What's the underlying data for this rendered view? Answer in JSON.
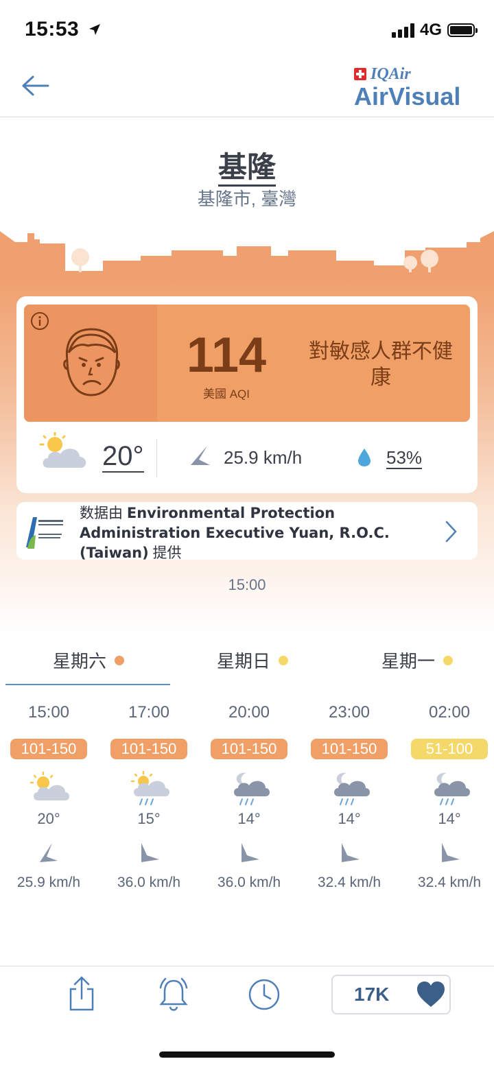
{
  "status_bar": {
    "time": "15:53",
    "network": "4G"
  },
  "header": {
    "back_icon": "arrow-left-icon",
    "logo_top": "IQAir",
    "logo_bottom": "AirVisual"
  },
  "location": {
    "city": "基隆",
    "region": "基隆市, 臺灣"
  },
  "aqi": {
    "value": "114",
    "label": "美國 AQI",
    "status": "對敏感人群不健康",
    "color": "#f0a066"
  },
  "current": {
    "temperature": "20°",
    "wind": "25.9 km/h",
    "humidity": "53%",
    "weather_icon": "partly-sunny-icon"
  },
  "source": {
    "prefix": "数据由 ",
    "name": "Environmental Protection Administration Executive Yuan, R.O.C. (Taiwan)",
    "suffix": " 提供"
  },
  "updated_time": "15:00",
  "days": [
    {
      "label": "星期六",
      "dot_color": "#f0a066"
    },
    {
      "label": "星期日",
      "dot_color": "#f5d86a"
    },
    {
      "label": "星期一",
      "dot_color": "#f5d86a"
    }
  ],
  "hourly": [
    {
      "time": "15:00",
      "aqi_range": "101-150",
      "badge_color": "#f0a066",
      "icon": "partly-sunny-icon",
      "temp": "20°",
      "wind": "25.9 km/h"
    },
    {
      "time": "17:00",
      "aqi_range": "101-150",
      "badge_color": "#f0a066",
      "icon": "sun-rain-icon",
      "temp": "15°",
      "wind": "36.0 km/h"
    },
    {
      "time": "20:00",
      "aqi_range": "101-150",
      "badge_color": "#f0a066",
      "icon": "night-rain-icon",
      "temp": "14°",
      "wind": "36.0 km/h"
    },
    {
      "time": "23:00",
      "aqi_range": "101-150",
      "badge_color": "#f0a066",
      "icon": "night-rain-icon",
      "temp": "14°",
      "wind": "32.4 km/h"
    },
    {
      "time": "02:00",
      "aqi_range": "51-100",
      "badge_color": "#f5d86a",
      "icon": "night-rain-icon",
      "temp": "14°",
      "wind": "32.4 km/h"
    }
  ],
  "bottom_bar": {
    "likes": "17K"
  }
}
